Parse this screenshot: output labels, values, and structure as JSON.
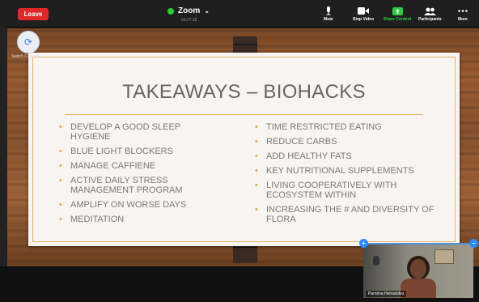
{
  "toolbar": {
    "leave_label": "Leave",
    "app_title": "Zoom",
    "title_chevron": "⌄",
    "timer": "03:27:15",
    "mute_label": "Mute",
    "stop_video_label": "Stop Video",
    "share_content_label": "Share Content",
    "participants_label": "Participants",
    "more_label": "More",
    "colors": {
      "leave": "#e02828",
      "share": "#2ecc40"
    }
  },
  "switch_camera": {
    "label": "Switch Camera",
    "icon": "switch-camera-icon"
  },
  "slide": {
    "title": "TAKEAWAYS – BIOHACKS",
    "left_items": [
      "DEVELOP A GOOD SLEEP HYGIENE",
      "BLUE LIGHT BLOCKERS",
      "MANAGE CAFFIENE",
      "ACTIVE DAILY STRESS MANAGEMENT PROGRAM",
      "AMPLIFY ON WORSE DAYS",
      "MEDITATION"
    ],
    "right_items": [
      "TIME RESTRICTED EATING",
      "REDUCE CARBS",
      "ADD HEALTHY FATS",
      "KEY NUTRITIONAL SUPPLEMENTS",
      "LIVING COOPERATIVELY WITH ECOSYSTEM WITHIN",
      "INCREASING THE # AND DIVERSITY OF FLORA"
    ],
    "accent": "#e6a34a"
  },
  "self_view": {
    "participant_name": "Purnima Hernandez",
    "expand_glyph": "+",
    "collapse_glyph": "–"
  }
}
